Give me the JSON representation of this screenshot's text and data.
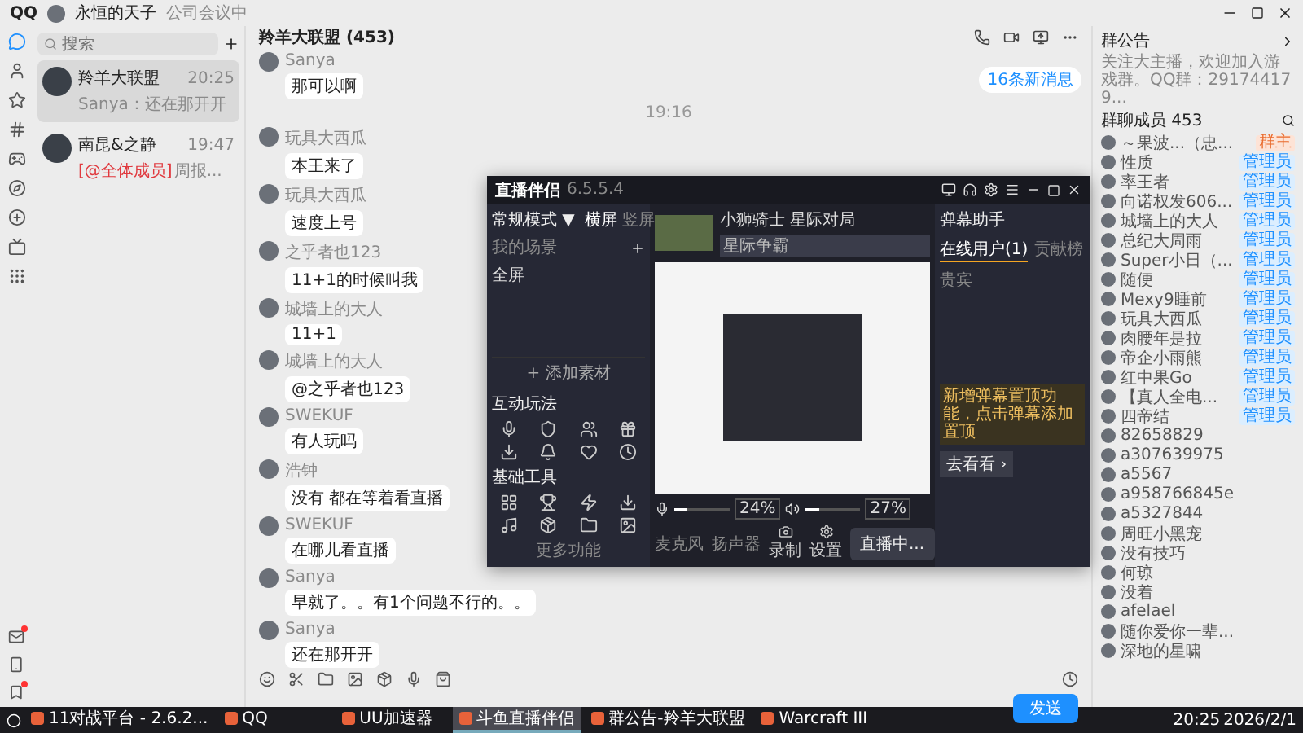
{
  "titlebar": {
    "app": "QQ",
    "user": "永恒的天子",
    "status": "公司会议中"
  },
  "rail": {
    "items": [
      {
        "kind": "chat",
        "selected": true
      },
      {
        "kind": "contacts",
        "selected": false
      },
      {
        "kind": "star",
        "selected": false
      },
      {
        "kind": "hash",
        "selected": false
      },
      {
        "kind": "game",
        "selected": false
      },
      {
        "kind": "compass",
        "selected": false
      },
      {
        "kind": "plus",
        "selected": false
      },
      {
        "kind": "tv",
        "selected": false
      },
      {
        "kind": "apps",
        "selected": false
      }
    ],
    "bottom": [
      {
        "kind": "mail",
        "badge": true
      },
      {
        "kind": "phone",
        "badge": false
      },
      {
        "kind": "bookmark",
        "badge": true
      }
    ]
  },
  "chat_list": {
    "search_placeholder": "搜索",
    "items": [
      {
        "name": "羚羊大联盟",
        "time": "20:25",
        "preview": "Sanya：还在那开开",
        "selected": true
      },
      {
        "name": "南昆&之静",
        "time": "19:47",
        "mention": "[@全体成员]",
        "preview": "周报...",
        "selected": false
      }
    ]
  },
  "chat": {
    "title": "羚羊大联盟 (453)",
    "new_messages": "16条新消息",
    "send": "发送",
    "messages": [
      {
        "kind": "message",
        "sender": "Sanya",
        "text": "那可以啊"
      },
      {
        "kind": "time",
        "text": "19:16"
      },
      {
        "kind": "message",
        "sender": "玩具大西瓜",
        "text": "本王来了"
      },
      {
        "kind": "message",
        "sender": "玩具大西瓜",
        "text": "速度上号"
      },
      {
        "kind": "message",
        "sender": "之乎者也123",
        "text": "11+1的时候叫我"
      },
      {
        "kind": "message",
        "sender": "城墙上的大人",
        "text": "11+1"
      },
      {
        "kind": "message",
        "sender": "城墙上的大人",
        "text": "@之乎者也123"
      },
      {
        "kind": "message",
        "sender": "SWEKUF",
        "text": "有人玩吗"
      },
      {
        "kind": "message",
        "sender": "浩钟",
        "text": "没有 都在等着看直播"
      },
      {
        "kind": "message",
        "sender": "SWEKUF",
        "text": "在哪儿看直播"
      },
      {
        "kind": "message",
        "sender": "Sanya",
        "text": "早就了。。有1个问题不行的。。"
      },
      {
        "kind": "message",
        "sender": "Sanya",
        "text": "还在那开开"
      }
    ]
  },
  "side": {
    "notice_title": "群公告",
    "notice": "关注大主播，欢迎加入游戏群。QQ群：291744179...",
    "members_title": "群聊成员 453",
    "members": [
      {
        "name": "～果波...（忠...",
        "role": "群主",
        "kind": "owner"
      },
      {
        "name": "性质",
        "role": "管理员",
        "kind": "admin"
      },
      {
        "name": "率王者",
        "role": "管理员",
        "kind": "admin"
      },
      {
        "name": "向诺权发606...",
        "role": "管理员",
        "kind": "admin"
      },
      {
        "name": "城墙上的大人",
        "role": "管理员",
        "kind": "admin"
      },
      {
        "name": "总纪大周雨",
        "role": "管理员",
        "kind": "admin"
      },
      {
        "name": "Super小日（...",
        "role": "管理员",
        "kind": "admin"
      },
      {
        "name": "随便",
        "role": "管理员",
        "kind": "admin"
      },
      {
        "name": "Mexy9睡前",
        "role": "管理员",
        "kind": "admin"
      },
      {
        "name": "玩具大西瓜",
        "role": "管理员",
        "kind": "admin"
      },
      {
        "name": "肉腰年是拉",
        "role": "管理员",
        "kind": "admin"
      },
      {
        "name": "帝企小雨熊",
        "role": "管理员",
        "kind": "admin"
      },
      {
        "name": "红中果Go",
        "role": "管理员",
        "kind": "admin"
      },
      {
        "name": "【真人全电...",
        "role": "管理员",
        "kind": "admin"
      },
      {
        "name": "四帝结",
        "role": "管理员",
        "kind": "admin"
      },
      {
        "name": "82658829",
        "kind": "member"
      },
      {
        "name": "a307639975",
        "kind": "member"
      },
      {
        "name": "a5567",
        "kind": "member"
      },
      {
        "name": "a958766845e",
        "kind": "member"
      },
      {
        "name": "a5327844",
        "kind": "member"
      },
      {
        "name": "周旺小黑宠",
        "kind": "member"
      },
      {
        "name": "没有技巧",
        "kind": "member"
      },
      {
        "name": "何琼",
        "kind": "member"
      },
      {
        "name": "没着",
        "kind": "member"
      },
      {
        "name": "afelael",
        "kind": "member"
      },
      {
        "name": "随你爱你一辈...",
        "kind": "member"
      },
      {
        "name": "深地的星啸",
        "kind": "member"
      }
    ]
  },
  "stream_app": {
    "name": "直播伴侣",
    "version": "6.5.5.4",
    "mode": "常规模式 ▼",
    "orientations": [
      {
        "label": "横屏",
        "selected": true
      },
      {
        "label": "竖屏",
        "selected": false
      }
    ],
    "scenes_title": "我的场景",
    "source": "全屏",
    "add_source": "+ 添加素材",
    "interactive_title": "互动玩法",
    "tools_title": "基础工具",
    "more": "更多功能",
    "stream_title": "小狮骑士 星际对局",
    "category": "星际争霸",
    "mixers": [
      {
        "kind": "mic",
        "label": "麦克风",
        "level": 0.24,
        "reading": "24%"
      },
      {
        "kind": "speaker",
        "label": "扬声器",
        "level": 0.27,
        "reading": "27%"
      }
    ],
    "actions": [
      {
        "kind": "record",
        "label": "录制"
      },
      {
        "kind": "settings",
        "label": "设置"
      }
    ],
    "live_button": "直播中...",
    "panel_title": "弹幕助手",
    "tabs": [
      {
        "label": "在线用户(1)",
        "selected": true
      },
      {
        "label": "贡献榜",
        "selected": false
      },
      {
        "label": "贵宾",
        "selected": false
      }
    ],
    "notice": "新增弹幕置顶功能，点击弹幕添加置顶",
    "notice_button": "去看看 ›"
  },
  "taskbar": {
    "items": [
      {
        "label": "11对战平台 - 2.6.2...",
        "selected": false
      },
      {
        "label": "QQ",
        "selected": false
      },
      {
        "label": "UU加速器",
        "selected": false
      },
      {
        "label": "斗鱼直播伴侣",
        "selected": true
      },
      {
        "label": "群公告-羚羊大联盟",
        "selected": false
      },
      {
        "label": "Warcraft III",
        "selected": false
      }
    ],
    "time": "20:25",
    "date": "2026/2/1"
  }
}
